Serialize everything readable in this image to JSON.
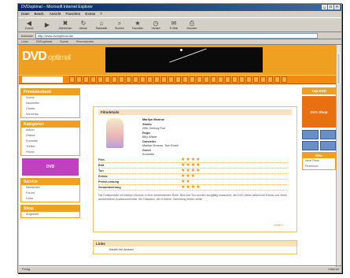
{
  "browser": {
    "title": "DVDoptimal – Microsoft Internet Explorer",
    "menus": [
      "Datei",
      "Bearb.",
      "Ansicht",
      "Favoriten",
      "Extras",
      "?"
    ],
    "toolbar": [
      {
        "icon": "back-icon",
        "label": "Zurück",
        "glyph": "◀"
      },
      {
        "icon": "forward-icon",
        "label": "",
        "glyph": "▶"
      },
      {
        "icon": "stop-icon",
        "label": "Abbrechen",
        "glyph": "✖"
      },
      {
        "icon": "refresh-icon",
        "label": "Aktual.",
        "glyph": "↻"
      },
      {
        "icon": "home-icon",
        "label": "Startseite",
        "glyph": "⌂"
      },
      {
        "icon": "search-icon",
        "label": "Suchen",
        "glyph": "⌕"
      },
      {
        "icon": "favorites-icon",
        "label": "Favoriten",
        "glyph": "★"
      },
      {
        "icon": "history-icon",
        "label": "Verlauf",
        "glyph": "◷"
      },
      {
        "icon": "mail-icon",
        "label": "E-Mail",
        "glyph": "✉"
      },
      {
        "icon": "print-icon",
        "label": "Drucken",
        "glyph": "⎙"
      }
    ],
    "address_label": "Adresse",
    "address": "http://www.dvdoptimal.de/",
    "links": [
      "Links",
      "DVDoptimal",
      "Suche",
      "Rezensionen"
    ],
    "status_left": "Fertig",
    "status_right": "Internet"
  },
  "site": {
    "logo": "DVD",
    "logo_suffix": "optimal",
    "sidebar": {
      "panel1": {
        "title": "Filmdatenbank",
        "items": [
          "Suche",
          "Neuheiten",
          "Charts",
          "Vorschau"
        ]
      },
      "panel2": {
        "title": "Kategorien",
        "items": [
          "Action",
          "Drama",
          "Komödie",
          "Thriller",
          "Horror"
        ]
      },
      "promo": "DVD",
      "panel3": {
        "title": "Service",
        "items": [
          "Newsletter",
          "Forum",
          "Links"
        ]
      },
      "panel4": {
        "title": "Shop",
        "items": [
          "Angebote"
        ]
      }
    },
    "film": {
      "section": "Filmdetails",
      "title": "Marilyn Monroe",
      "meta": [
        {
          "label": "Studio",
          "value": "20th Century Fox"
        },
        {
          "label": "Regie",
          "value": "Billy Wilder"
        },
        {
          "label": "Darsteller",
          "value": "Marilyn Monroe, Tom Ewell"
        },
        {
          "label": "Genre",
          "value": "Komödie"
        }
      ],
      "ratings": [
        {
          "label": "Film",
          "value": 4,
          "stars": "★★★★"
        },
        {
          "label": "Bild",
          "value": 4,
          "stars": "★★★★"
        },
        {
          "label": "Ton",
          "value": 4,
          "stars": "★★★★"
        },
        {
          "label": "Extras",
          "value": 3,
          "stars": "★★★"
        },
        {
          "label": "Preis/Leistung",
          "value": 2,
          "stars": "★★"
        },
        {
          "label": "Gesamtwertung",
          "value": 4,
          "stars": "★★★★"
        }
      ],
      "description": "Die Kultkomödie mit Marilyn Monroe in ihrer berühmtesten Rolle. Bild und Ton wurden sorgfältig restauriert, die DVD bietet zahlreiche Extras und einen ausführlichen Audiokommentar. Ein Klassiker, der in keiner Sammlung fehlen sollte.",
      "more": "weiter »"
    },
    "section2": {
      "title": "Links",
      "row": "Kaufen bei Amazon"
    },
    "right": {
      "box1": "Top DVD",
      "ad": "DVD Shop",
      "box2": "Neu",
      "items": [
        "Neue Filme",
        "Rezension"
      ]
    }
  }
}
